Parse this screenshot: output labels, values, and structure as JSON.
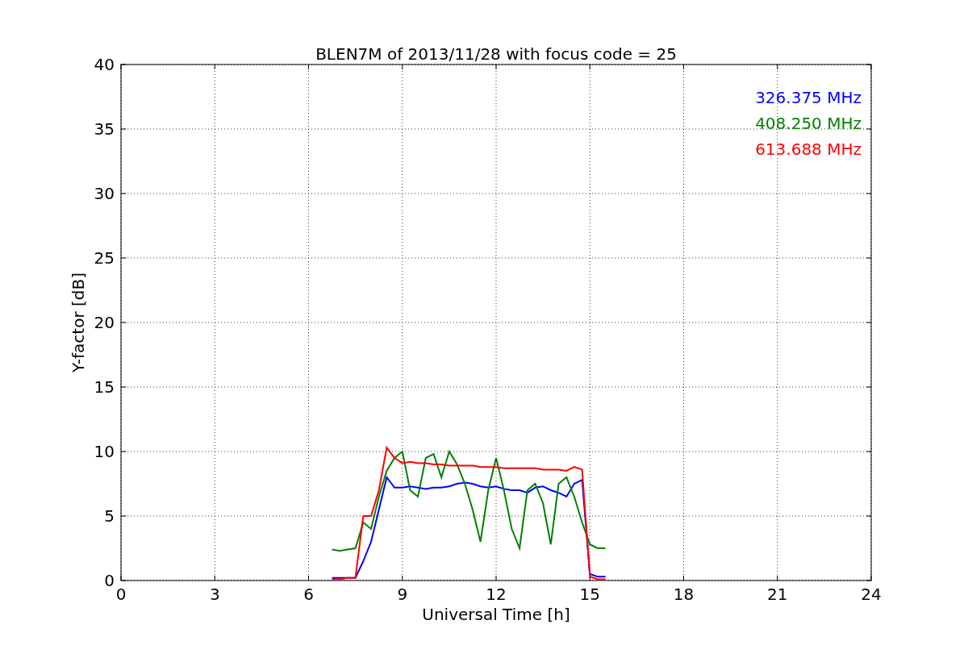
{
  "chart_data": {
    "type": "line",
    "title": "BLEN7M of 2013/11/28 with focus code = 25",
    "xlabel": "Universal Time [h]",
    "ylabel": "Y-factor [dB]",
    "x": [
      6.75,
      7.0,
      7.25,
      7.5,
      7.75,
      8.0,
      8.25,
      8.5,
      8.75,
      9.0,
      9.25,
      9.5,
      9.75,
      10.0,
      10.25,
      10.5,
      10.75,
      11.0,
      11.25,
      11.5,
      11.75,
      12.0,
      12.25,
      12.5,
      12.75,
      13.0,
      13.25,
      13.5,
      13.75,
      14.0,
      14.25,
      14.5,
      14.75,
      15.0,
      15.25,
      15.5
    ],
    "series": [
      {
        "name": "326.375 MHz",
        "color": "#0000ff",
        "values": [
          0.2,
          0.2,
          0.2,
          0.2,
          1.5,
          3,
          5.5,
          8,
          7.2,
          7.2,
          7.3,
          7.2,
          7.1,
          7.2,
          7.2,
          7.3,
          7.5,
          7.6,
          7.5,
          7.3,
          7.2,
          7.3,
          7.1,
          7.0,
          7.0,
          6.8,
          7.2,
          7.3,
          7.0,
          6.8,
          6.5,
          7.5,
          7.8,
          0.5,
          0.3,
          0.3
        ]
      },
      {
        "name": "408.250 MHz",
        "color": "#008000",
        "values": [
          2.4,
          2.3,
          2.4,
          2.5,
          4.5,
          4,
          6.5,
          8.5,
          9.5,
          10,
          7,
          6.5,
          9.5,
          9.8,
          8,
          10,
          9,
          7.5,
          5.5,
          3,
          7,
          9.5,
          7,
          4,
          2.5,
          7,
          7.5,
          6,
          2.8,
          7.5,
          8,
          6.5,
          4.5,
          2.8,
          2.5,
          2.5
        ]
      },
      {
        "name": "613.688 MHz",
        "color": "#ff0000",
        "values": [
          0.1,
          0.1,
          0.2,
          0.2,
          5,
          5,
          7,
          10.3,
          9.5,
          9.1,
          9.2,
          9.1,
          9.1,
          9.0,
          9.0,
          8.9,
          8.9,
          8.9,
          8.9,
          8.8,
          8.8,
          8.8,
          8.7,
          8.7,
          8.7,
          8.7,
          8.7,
          8.6,
          8.6,
          8.6,
          8.5,
          8.8,
          8.6,
          0.3,
          0.1,
          0.1
        ]
      }
    ],
    "xlim": [
      0,
      24
    ],
    "ylim": [
      0,
      40
    ],
    "xticks": [
      0,
      3,
      6,
      9,
      12,
      15,
      18,
      21,
      24
    ],
    "yticks": [
      0,
      5,
      10,
      15,
      20,
      25,
      30,
      35,
      40
    ],
    "grid": true
  }
}
